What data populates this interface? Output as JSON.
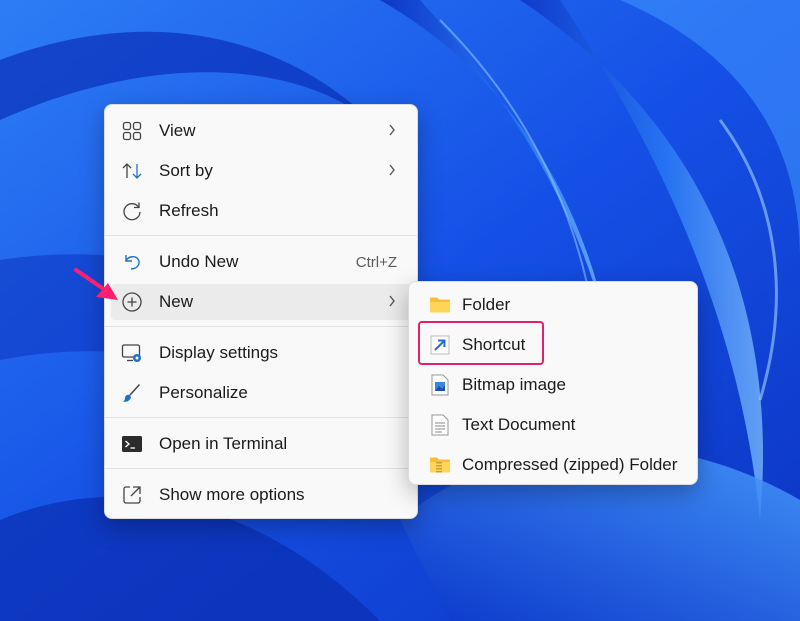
{
  "context_menu": {
    "items": [
      {
        "label": "View",
        "icon": "grid-view-icon"
      },
      {
        "label": "Sort by",
        "icon": "sort-icon"
      },
      {
        "label": "Refresh",
        "icon": "refresh-icon"
      },
      {
        "label": "Undo New",
        "icon": "undo-icon",
        "shortcut": "Ctrl+Z"
      },
      {
        "label": "New",
        "icon": "plus-circle-icon"
      },
      {
        "label": "Display settings",
        "icon": "display-settings-icon"
      },
      {
        "label": "Personalize",
        "icon": "brush-icon"
      },
      {
        "label": "Open in Terminal",
        "icon": "terminal-icon"
      },
      {
        "label": "Show more options",
        "icon": "open-external-icon"
      }
    ]
  },
  "new_submenu": {
    "items": [
      {
        "label": "Folder",
        "icon": "folder-icon"
      },
      {
        "label": "Shortcut",
        "icon": "shortcut-arrow-icon"
      },
      {
        "label": "Bitmap image",
        "icon": "bitmap-image-icon"
      },
      {
        "label": "Text Document",
        "icon": "text-document-icon"
      },
      {
        "label": "Compressed (zipped) Folder",
        "icon": "zip-folder-icon"
      }
    ]
  },
  "colors": {
    "wallpaper_blue": "#1a56e8",
    "annotation_pink": "#e3206d",
    "menu_bg": "#f9f9f9",
    "accent_blue": "#1f6fd1"
  }
}
